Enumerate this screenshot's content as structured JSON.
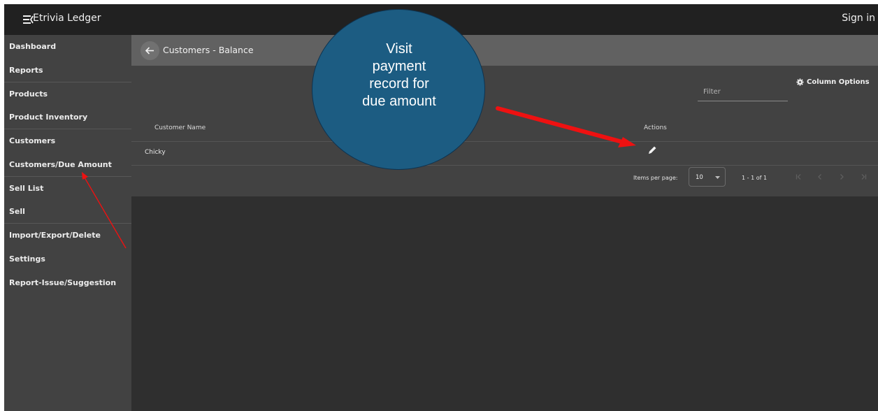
{
  "app": {
    "title": "Etrivia Ledger",
    "signin_label": "Sign in"
  },
  "sidebar": {
    "items": [
      {
        "label": "Dashboard"
      },
      {
        "label": "Reports"
      },
      {
        "label": "Products"
      },
      {
        "label": "Product Inventory"
      },
      {
        "label": "Customers"
      },
      {
        "label": "Customers/Due Amount"
      },
      {
        "label": "Sell List"
      },
      {
        "label": "Sell"
      },
      {
        "label": "Import/Export/Delete"
      },
      {
        "label": "Settings"
      },
      {
        "label": "Report-Issue/Suggestion"
      }
    ]
  },
  "header": {
    "title": "Customers - Balance"
  },
  "table": {
    "filter_placeholder": "Filter",
    "column_options_label": "Column Options",
    "columns": [
      "Customer Name",
      "Actions"
    ],
    "rows": [
      {
        "customer_name": "Chicky"
      }
    ]
  },
  "paginator": {
    "items_per_page_label": "Items per page:",
    "page_size": "10",
    "range_label": "1 - 1 of 1"
  },
  "annotation": {
    "callout_lines": [
      "Visit",
      "payment",
      "record for",
      "due amount"
    ],
    "arrow_color": "#ee1111",
    "bubble_color": "#1c5c82"
  }
}
